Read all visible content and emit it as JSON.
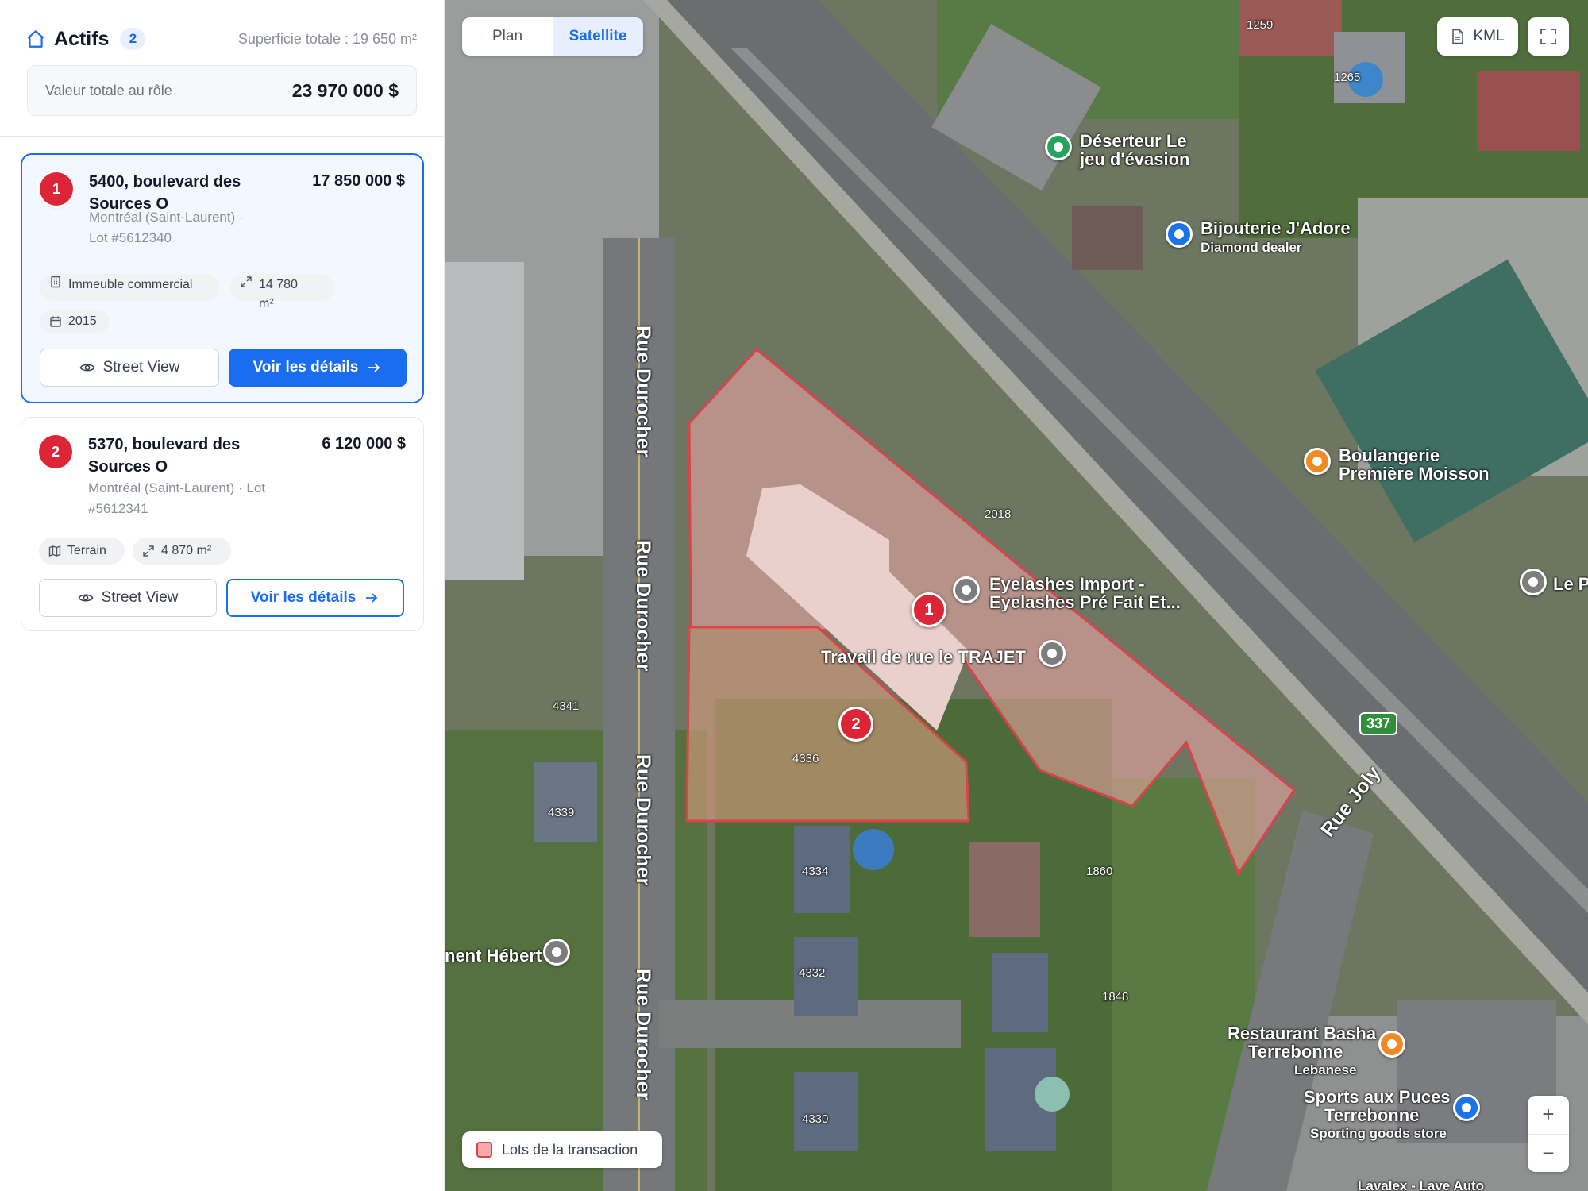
{
  "sidebar": {
    "title": "Actifs",
    "count": "2",
    "area_total": "Superficie totale : 19 650 m²",
    "total_label": "Valeur totale au rôle",
    "total_value": "23 970 000 $",
    "cards": [
      {
        "number": "1",
        "address": "5400, boulevard des Sources O",
        "price": "17 850 000 $",
        "location": "Montréal (Saint-Laurent) ·",
        "lot": "Lot #5612340",
        "type": "Immeuble commercial",
        "area": "14 780 m²",
        "year": "2015",
        "street_view": "Street View",
        "details": "Voir les détails",
        "selected": true
      },
      {
        "number": "2",
        "address": "5370, boulevard des Sources O",
        "price": "6 120 000 $",
        "location": "Montréal (Saint-Laurent) · Lot",
        "lot": "#5612341",
        "type": "Terrain",
        "area": "4 870 m²",
        "street_view": "Street View",
        "details": "Voir les détails",
        "selected": false
      }
    ]
  },
  "map": {
    "tabs": [
      "Plan",
      "Satellite"
    ],
    "active_tab": "Satellite",
    "kml_label": "KML",
    "zoom_in": "+",
    "zoom_out": "−",
    "legend_label": "Lots de la transaction",
    "pins": [
      "1",
      "2"
    ],
    "labels": {
      "deserteur_1": "Déserteur Le",
      "deserteur_2": "jeu d'évasion",
      "bijouterie": "Bijouterie J'Adore",
      "bijouterie_sub": "Diamond dealer",
      "boulangerie_1": "Boulangerie",
      "boulangerie_2": "Première Moisson",
      "eyelashes_1": "Eyelashes Import -",
      "eyelashes_2": "Eyelashes Pré Fait Et...",
      "trajet": "Travail de rue le TRAJET",
      "le_pa": "Le Pa",
      "hebert": "nent Hébert",
      "basha_1": "Restaurant Basha",
      "basha_2": "Terrebonne",
      "basha_sub": "Lebanese",
      "sports_1": "Sports aux Puces",
      "sports_2": "Terrebonne",
      "sports_sub": "Sporting goods store",
      "lavalex": "Lavalex - Lave Auto"
    },
    "roads": {
      "durocher": "Rue Durocher",
      "joly": "Rue Joly",
      "route": "337"
    },
    "house_numbers": [
      "1259",
      "1265",
      "2018",
      "4341",
      "4336",
      "4339",
      "4334",
      "4332",
      "4330",
      "1860",
      "1848"
    ],
    "colors": {
      "accent": "#1a6cf0",
      "pin": "#dc2638",
      "lot_fill": "#f5a9a9",
      "lot_stroke": "#d9434a"
    }
  }
}
